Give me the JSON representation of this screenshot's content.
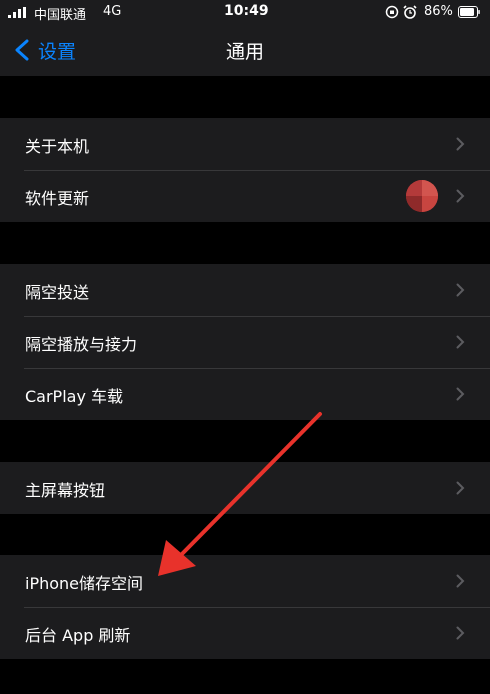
{
  "status_bar": {
    "carrier": "中国联通",
    "network": "4G",
    "time": "10:49",
    "battery": "86%"
  },
  "nav": {
    "back_label": "设置",
    "title": "通用"
  },
  "groups": [
    {
      "rows": [
        {
          "label": "关于本机"
        },
        {
          "label": "软件更新"
        }
      ]
    },
    {
      "rows": [
        {
          "label": "隔空投送"
        },
        {
          "label": "隔空播放与接力"
        },
        {
          "label": "CarPlay 车载"
        }
      ]
    },
    {
      "rows": [
        {
          "label": "主屏幕按钮"
        }
      ]
    },
    {
      "rows": [
        {
          "label": "iPhone储存空间"
        },
        {
          "label": "后台 App 刷新"
        }
      ]
    }
  ],
  "colors": {
    "background": "#000000",
    "cell": "#1c1c1e",
    "accent": "#0a84ff",
    "annotation_arrow": "#e8322b"
  },
  "icons": [
    "signal-icon",
    "orientation-lock-icon",
    "alarm-icon",
    "battery-icon",
    "chevron-left-icon",
    "chevron-right-icon"
  ]
}
